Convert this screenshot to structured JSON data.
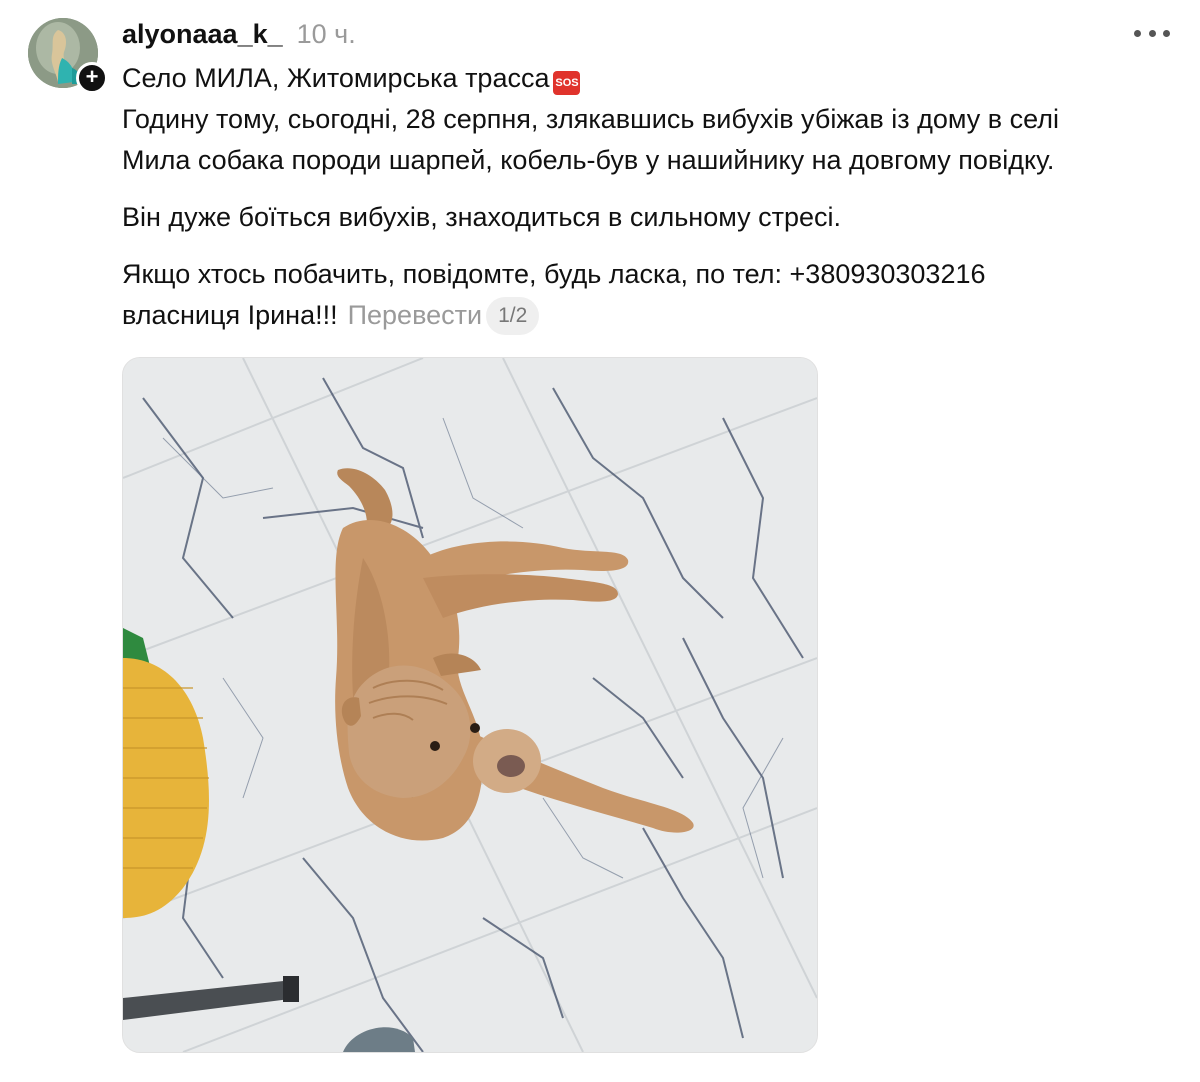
{
  "post": {
    "username": "alyonaaa_k_",
    "time": "10 ч.",
    "follow_symbol": "+",
    "lines": {
      "l1": "Село МИЛА, Житомирська трасса",
      "l2": "Годину тому, сьогодні, 28 серпня, злякавшись вибухів убіжав із дому в селі",
      "l3": "Мила собака породи шарпей, кобель-був у нашийнику на довгому повідку.",
      "l4": "Він дуже боїться вибухів, знаходиться в сильному стресі.",
      "l5": "Якщо хтось побачить, повідомте, будь ласка, по тел: +380930303216",
      "l6": "власниця Ірина!!!"
    },
    "sos_label": "SOS",
    "translate_label": "Перевести",
    "counter": "1/2"
  },
  "icons": {
    "avatar": "profile-avatar-icon",
    "follow": "plus-icon",
    "more": "ellipsis-icon",
    "sos": "sos-emoji-icon"
  },
  "colors": {
    "text": "#111111",
    "muted": "#9a9a9a",
    "sos": "#e0332c",
    "badge": "#111111"
  }
}
